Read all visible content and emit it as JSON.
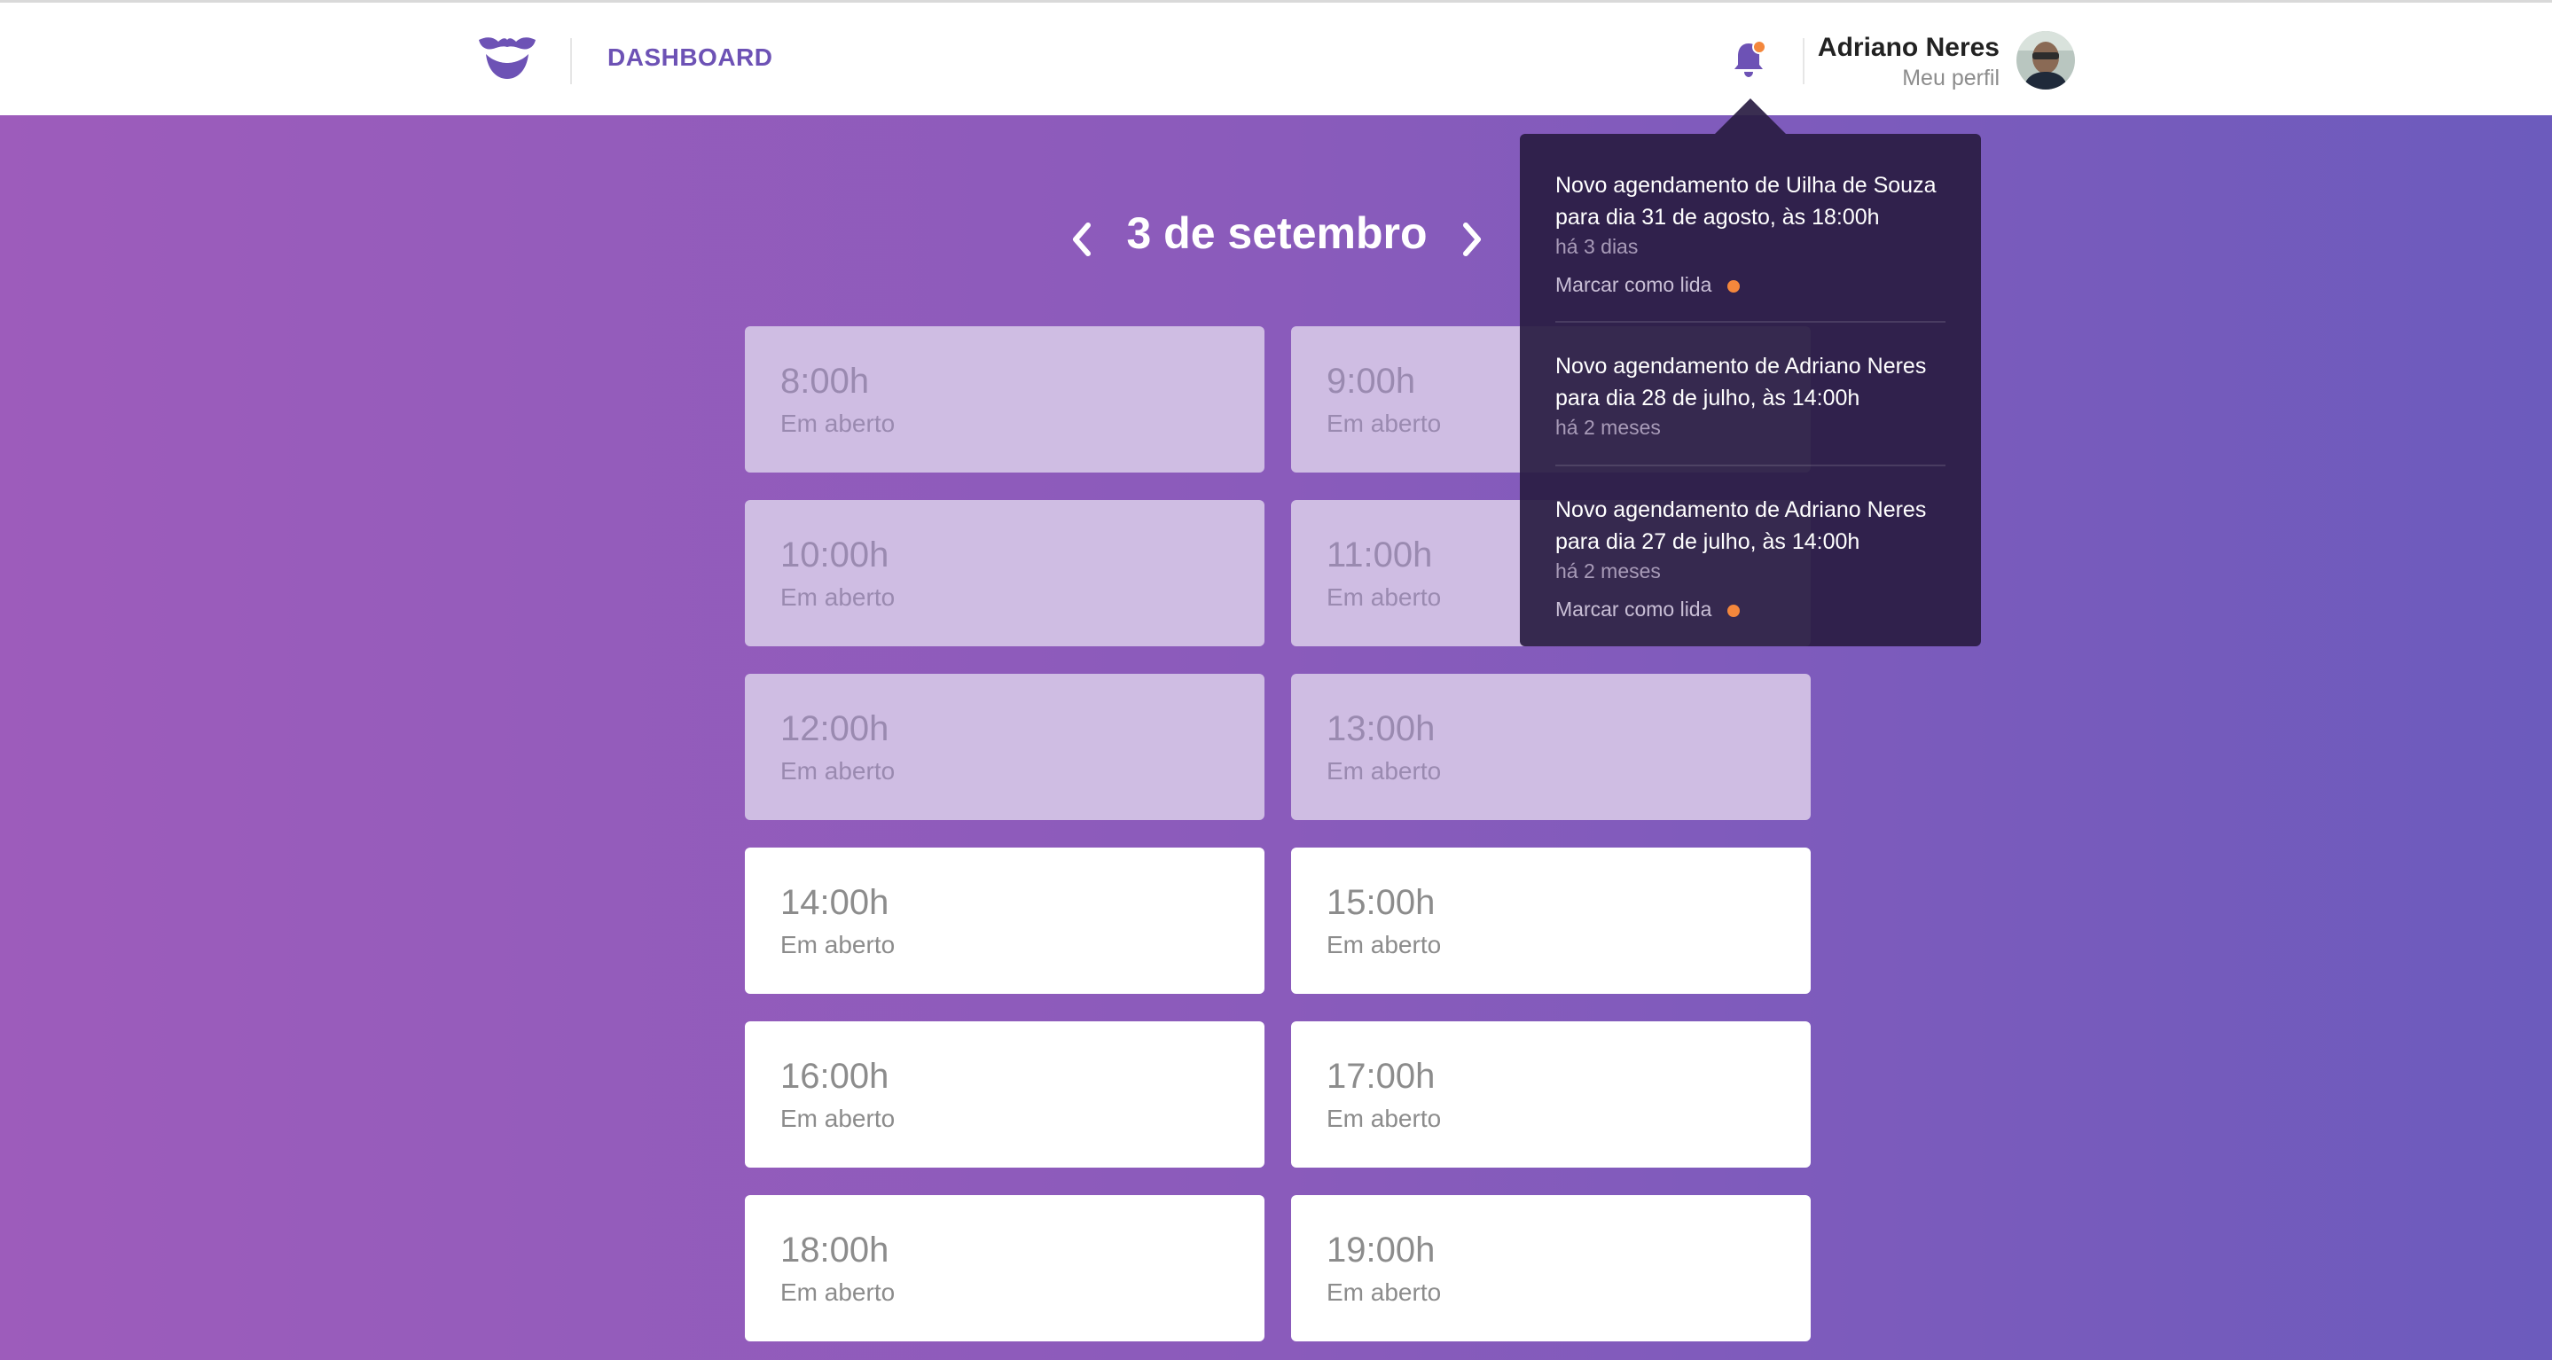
{
  "header": {
    "nav_label": "DASHBOARD",
    "user_name": "Adriano Neres",
    "user_link": "Meu perfil",
    "brand_color": "#6d52b5",
    "logo_icon": "mustache-icon",
    "bell_icon": "bell-icon"
  },
  "schedule": {
    "date_title": "3 de setembro",
    "prev_icon": "chevron-left-icon",
    "next_icon": "chevron-right-icon",
    "slots": [
      {
        "time": "8:00h",
        "status": "Em aberto",
        "state": "past"
      },
      {
        "time": "9:00h",
        "status": "Em aberto",
        "state": "past"
      },
      {
        "time": "10:00h",
        "status": "Em aberto",
        "state": "past"
      },
      {
        "time": "11:00h",
        "status": "Em aberto",
        "state": "past"
      },
      {
        "time": "12:00h",
        "status": "Em aberto",
        "state": "past"
      },
      {
        "time": "13:00h",
        "status": "Em aberto",
        "state": "past"
      },
      {
        "time": "14:00h",
        "status": "Em aberto",
        "state": "open"
      },
      {
        "time": "15:00h",
        "status": "Em aberto",
        "state": "open"
      },
      {
        "time": "16:00h",
        "status": "Em aberto",
        "state": "open"
      },
      {
        "time": "17:00h",
        "status": "Em aberto",
        "state": "open"
      },
      {
        "time": "18:00h",
        "status": "Em aberto",
        "state": "open"
      },
      {
        "time": "19:00h",
        "status": "Em aberto",
        "state": "open"
      }
    ]
  },
  "notifications": {
    "items": [
      {
        "line1": "Novo agendamento de Uilha de Souza",
        "line2": "para dia 31 de agosto, às 18:00h",
        "time_ago": "há 3 dias",
        "mark_label": "Marcar como lida",
        "unread": true
      },
      {
        "line1": "Novo agendamento de Adriano Neres",
        "line2": "para dia 28 de julho, às 14:00h",
        "time_ago": "há 2 meses",
        "mark_label": "",
        "unread": false
      },
      {
        "line1": "Novo agendamento de Adriano Neres",
        "line2": "para dia 27 de julho, às 14:00h",
        "time_ago": "há 2 meses",
        "mark_label": "Marcar como lida",
        "unread": true
      }
    ],
    "unread_dot_color": "#f4873c"
  }
}
